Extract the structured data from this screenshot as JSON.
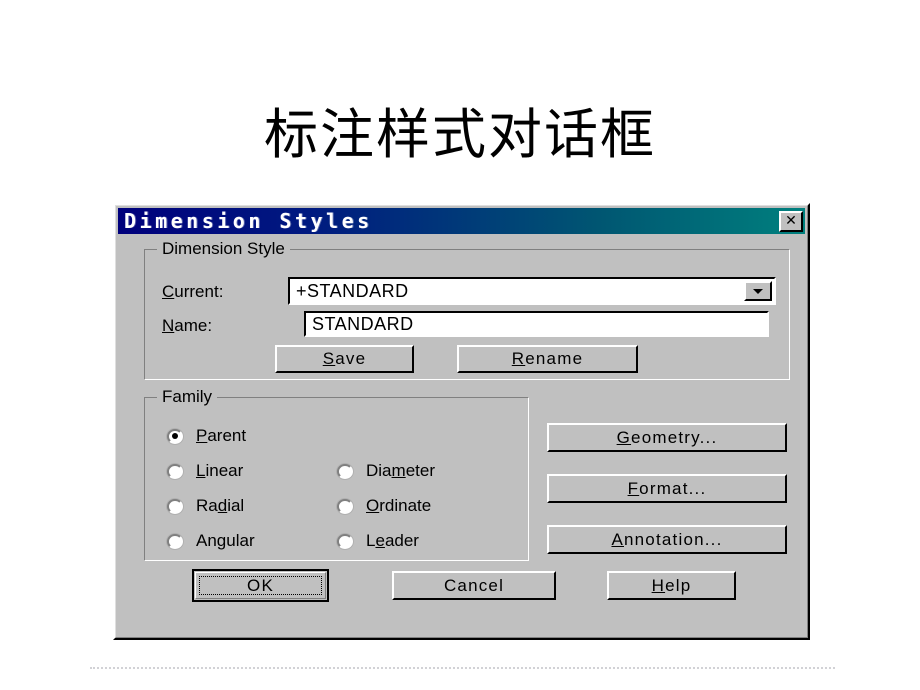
{
  "slide": {
    "title": "标注样式对话框"
  },
  "dialog": {
    "titlebar": {
      "title": "Dimension  Styles",
      "close_label": "✕"
    },
    "groups": {
      "dimension_style": {
        "legend": "Dimension Style",
        "fields": [
          {
            "label_prefix": "C",
            "label_rest": "urrent:",
            "value": "+STANDARD",
            "type": "combobox"
          },
          {
            "label_prefix": "N",
            "label_rest": "ame:",
            "value": "STANDARD",
            "type": "textbox"
          }
        ],
        "buttons": [
          {
            "mnemonic": "S",
            "rest": "ave"
          },
          {
            "mnemonic": "R",
            "rest": "ename"
          }
        ]
      },
      "family": {
        "legend": "Family",
        "options": [
          {
            "pre": "",
            "mn": "P",
            "post": "arent",
            "selected": true
          },
          {
            "pre": "",
            "mn": "L",
            "post": "inear",
            "selected": false
          },
          {
            "pre": "Ra",
            "mn": "d",
            "post": "ial",
            "selected": false
          },
          {
            "pre": "An",
            "mn": "g",
            "post": "ular",
            "selected": false
          },
          {
            "pre": "Dia",
            "mn": "m",
            "post": "eter",
            "selected": false
          },
          {
            "pre": "",
            "mn": "O",
            "post": "rdinate",
            "selected": false
          },
          {
            "pre": "L",
            "mn": "e",
            "post": "ader",
            "selected": false
          }
        ]
      }
    },
    "side_buttons": [
      {
        "mnemonic": "G",
        "rest": "eometry..."
      },
      {
        "mnemonic": "F",
        "rest": "ormat..."
      },
      {
        "mnemonic": "A",
        "rest": "nnotation..."
      }
    ],
    "footer_buttons": {
      "ok": "OK",
      "cancel": "Cancel",
      "help_mnemonic": "H",
      "help_rest": "elp"
    }
  },
  "colors": {
    "dialog_face": "#c0c0c0",
    "titlebar_left": "#00007c",
    "titlebar_right": "#00807e",
    "field_bg": "#ffffff",
    "text": "#000000"
  }
}
